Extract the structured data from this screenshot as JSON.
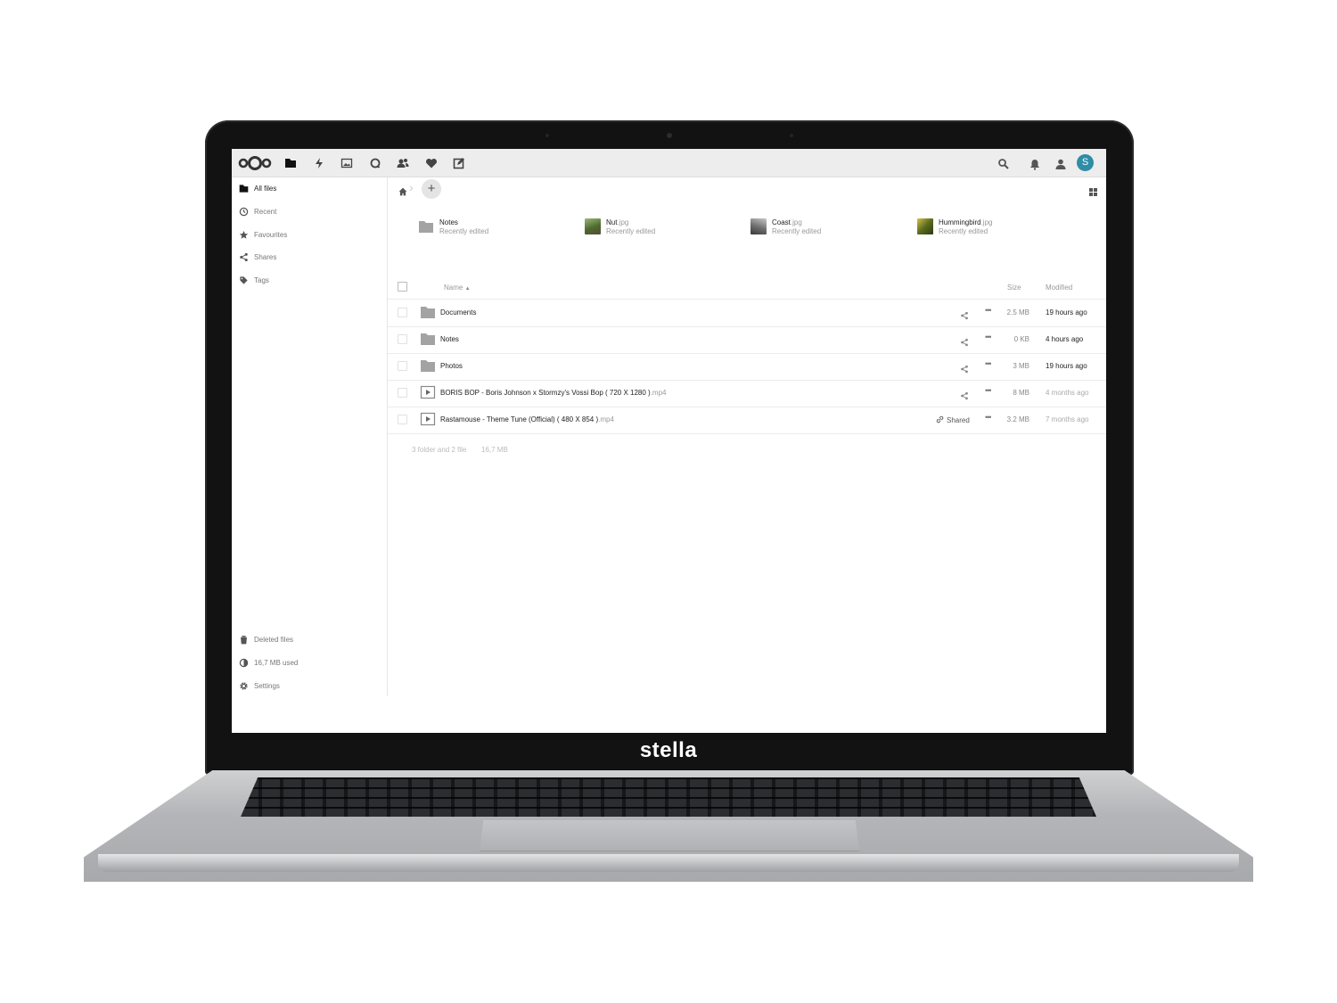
{
  "device": {
    "brand_label": "stella"
  },
  "topbar": {
    "apps": [
      {
        "name": "files",
        "icon": "folder-icon"
      },
      {
        "name": "activity",
        "icon": "bolt-icon"
      },
      {
        "name": "photos",
        "icon": "image-icon"
      },
      {
        "name": "talk",
        "icon": "search-bubble-icon"
      },
      {
        "name": "contacts",
        "icon": "contacts-icon"
      },
      {
        "name": "favorites",
        "icon": "heart-icon"
      },
      {
        "name": "notes",
        "icon": "edit-icon"
      }
    ],
    "avatar_initial": "S",
    "avatar_color": "#2f8da6"
  },
  "sidebar": {
    "items": [
      {
        "label": "All files",
        "icon": "folder-icon",
        "active": true
      },
      {
        "label": "Recent",
        "icon": "clock-icon"
      },
      {
        "label": "Favourites",
        "icon": "star-icon"
      },
      {
        "label": "Shares",
        "icon": "share-icon"
      },
      {
        "label": "Tags",
        "icon": "tag-icon"
      }
    ],
    "bottom": [
      {
        "label": "Deleted files",
        "icon": "trash-icon"
      },
      {
        "label": "16,7 MB used",
        "icon": "quota-icon"
      },
      {
        "label": "Settings",
        "icon": "gear-icon"
      }
    ]
  },
  "recent": [
    {
      "name": "Notes",
      "ext": "",
      "sub": "Recently edited",
      "kind": "folder"
    },
    {
      "name": "Nut",
      "ext": ".jpg",
      "sub": "Recently edited",
      "kind": "image"
    },
    {
      "name": "Coast",
      "ext": ".jpg",
      "sub": "Recently edited",
      "kind": "image"
    },
    {
      "name": "Hummingbird",
      "ext": ".jpg",
      "sub": "Recently edited",
      "kind": "image"
    }
  ],
  "table": {
    "headers": {
      "name": "Name",
      "size": "Size",
      "modified": "Modified"
    },
    "rows": [
      {
        "name": "Documents",
        "ext": "",
        "kind": "folder",
        "size": "2.5 MB",
        "modified": "19 hours ago",
        "shared": ""
      },
      {
        "name": "Notes",
        "ext": "",
        "kind": "folder",
        "size": "0 KB",
        "modified": "4 hours ago",
        "shared": ""
      },
      {
        "name": "Photos",
        "ext": "",
        "kind": "folder",
        "size": "3 MB",
        "modified": "19 hours ago",
        "shared": ""
      },
      {
        "name": "BORIS BOP - Boris Johnson x Stormzy's Vossi Bop ( 720 X 1280 )",
        "ext": ".mp4",
        "kind": "video",
        "size": "8 MB",
        "modified": "4 months ago",
        "shared": ""
      },
      {
        "name": "Rastamouse - Theme Tune (Official) ( 480 X 854 )",
        "ext": ".mp4",
        "kind": "video",
        "size": "3.2 MB",
        "modified": "7 months ago",
        "shared": "Shared"
      }
    ],
    "summary_count": "3 folder and 2 file",
    "summary_size": "16,7 MB"
  }
}
